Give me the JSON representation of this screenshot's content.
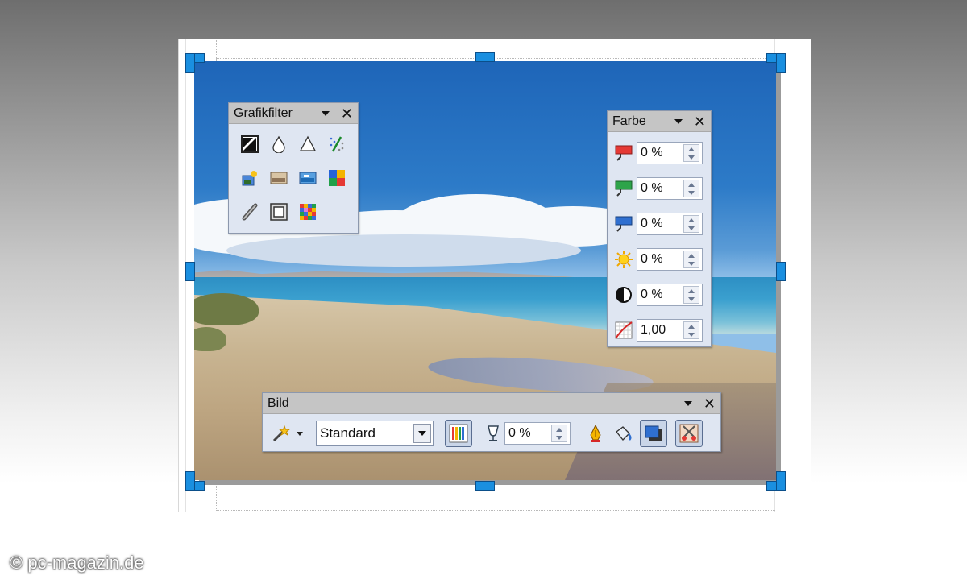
{
  "grafikfilter": {
    "title": "Grafikfilter",
    "tools": [
      {
        "icon": "invert-icon"
      },
      {
        "icon": "smooth-icon"
      },
      {
        "icon": "sharpen-icon"
      },
      {
        "icon": "remove-noise-icon"
      },
      {
        "icon": "solarization-icon"
      },
      {
        "icon": "aging-icon"
      },
      {
        "icon": "posterize-icon"
      },
      {
        "icon": "pop-art-icon"
      },
      {
        "icon": "charcoal-sketch-icon"
      },
      {
        "icon": "relief-icon"
      },
      {
        "icon": "mosaic-icon"
      }
    ]
  },
  "farbe": {
    "title": "Farbe",
    "rows": [
      {
        "icon": "red-icon",
        "value": "0 %"
      },
      {
        "icon": "green-icon",
        "value": "0 %"
      },
      {
        "icon": "blue-icon",
        "value": "0 %"
      },
      {
        "icon": "brightness-icon",
        "value": "0 %"
      },
      {
        "icon": "contrast-icon",
        "value": "0 %"
      },
      {
        "icon": "gamma-icon",
        "value": "1,00"
      }
    ]
  },
  "bild": {
    "title": "Bild",
    "graphics_mode": "Standard",
    "transparency": "0 %"
  },
  "credit": "© pc-magazin.de",
  "colors": {
    "handle": "#1a8fe0",
    "panel_bg": "#dfe6f2",
    "title_bar": "#c5c5c5"
  }
}
